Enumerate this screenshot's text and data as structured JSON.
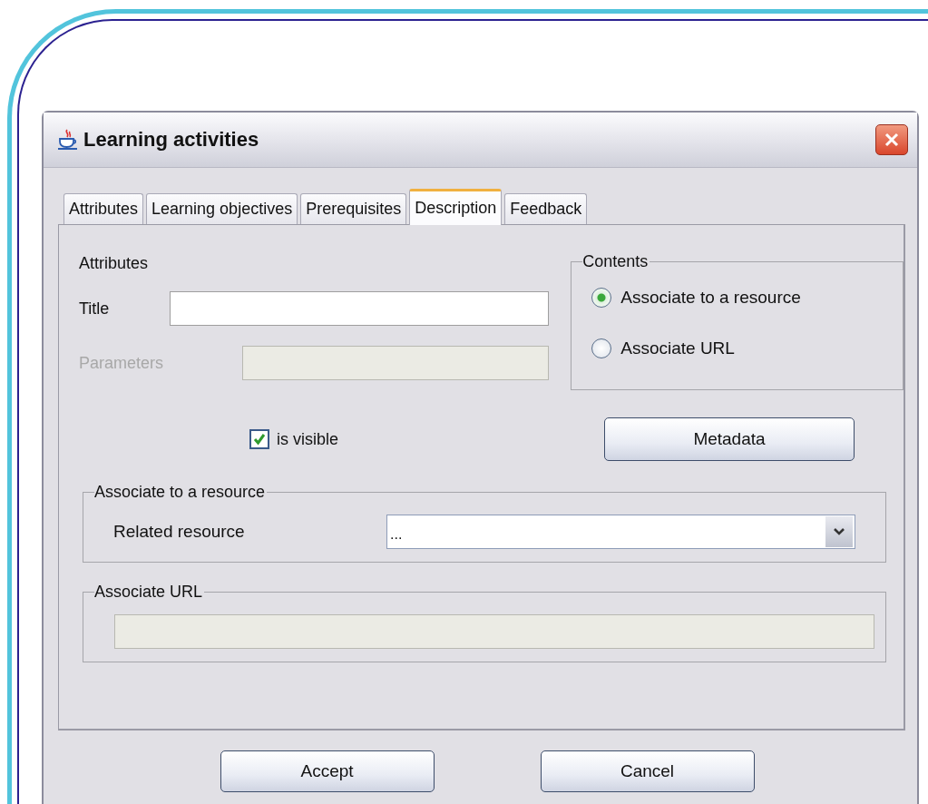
{
  "window": {
    "title": "Learning activities"
  },
  "tabs": [
    {
      "label": "Attributes",
      "selected": false
    },
    {
      "label": "Learning objectives",
      "selected": false
    },
    {
      "label": "Prerequisites",
      "selected": false
    },
    {
      "label": "Description",
      "selected": true
    },
    {
      "label": "Feedback",
      "selected": false
    }
  ],
  "attributes": {
    "heading": "Attributes",
    "fields": [
      {
        "label": "Title",
        "disabled": false
      },
      {
        "label": "Parameters",
        "disabled": true
      }
    ]
  },
  "is_visible": {
    "label": "is visible",
    "checked": true
  },
  "contents": {
    "legend": "Contents",
    "options": [
      {
        "label": "Associate to a resource",
        "selected": true
      },
      {
        "label": "Associate URL",
        "selected": false
      }
    ]
  },
  "metadata_button": "Metadata",
  "resource_group": {
    "legend": "Associate to a resource",
    "label": "Related resource",
    "value": "..."
  },
  "url_group": {
    "legend": "Associate URL",
    "disabled": true
  },
  "buttons": [
    "Accept",
    "Cancel"
  ]
}
